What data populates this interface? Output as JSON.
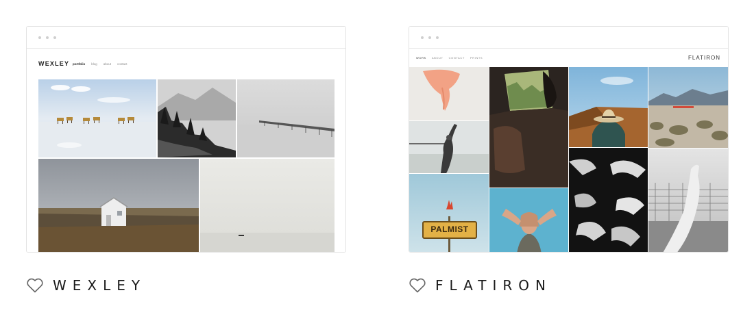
{
  "templates": [
    {
      "name": "WEXLEY",
      "preview": {
        "logo": "WEXLEY",
        "nav": [
          "portfolio",
          "blog",
          "about",
          "contact"
        ],
        "active_nav": "portfolio",
        "images": [
          "salt-flat-caravan",
          "misty-mountain-cliffs",
          "foggy-pier",
          "white-cabin-tundra",
          "hazy-sea-boat"
        ]
      }
    },
    {
      "name": "FLATIRON",
      "preview": {
        "logo": "FLATIRON",
        "nav": [
          "WORK",
          "ABOUT",
          "CONTACT",
          "PRINTS"
        ],
        "active_nav": "WORK",
        "sign_text": "PALMIST",
        "images": [
          "orange-scarf",
          "beach-pier-woman",
          "car-interior",
          "desert-hat",
          "palmist-sign",
          "hands-over-face",
          "hands-collage",
          "mountain-desert",
          "hand-fence"
        ]
      }
    }
  ],
  "favorite_icon": "heart-outline-icon",
  "window_dots_icon": "window-dots-icon",
  "colors": {
    "text": "#1a1a1a",
    "border": "#e2e2e2",
    "dot": "#cfcfcf"
  }
}
